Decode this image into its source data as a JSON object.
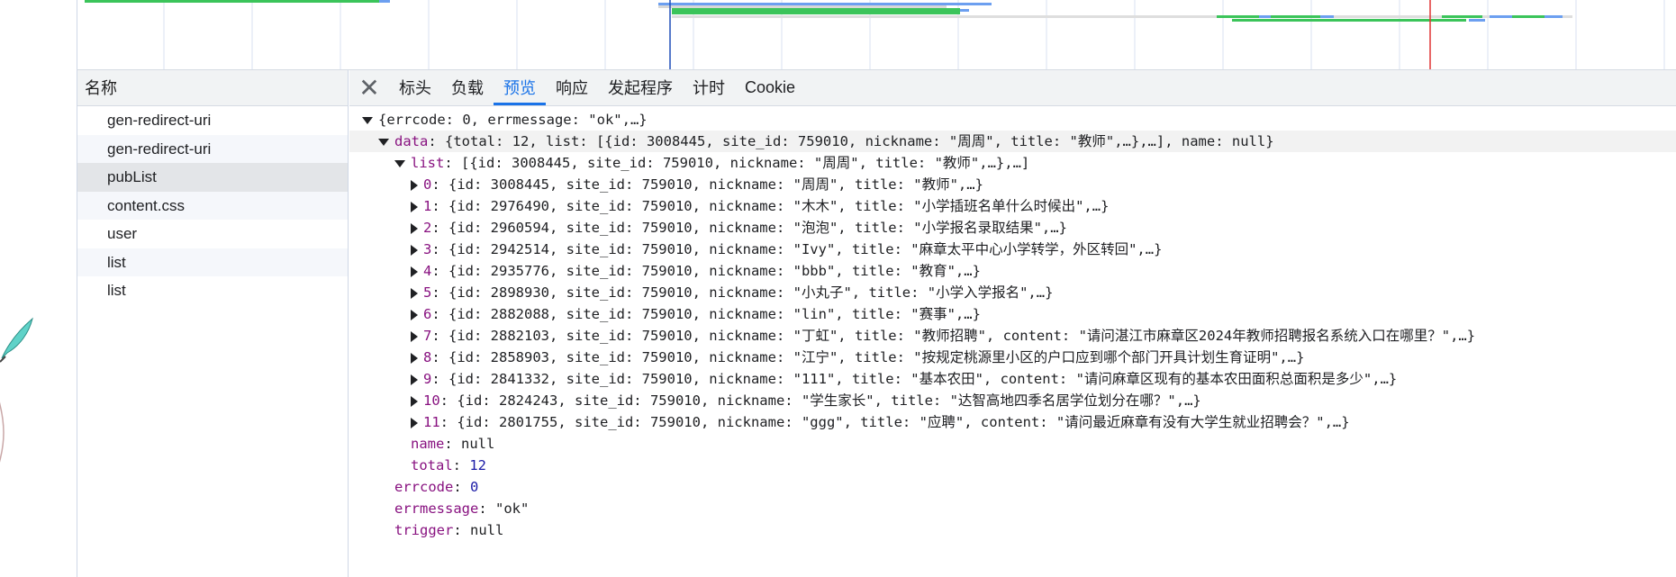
{
  "colors": {
    "timeline_green": "#3bc45a",
    "timeline_blue": "#6c9ff0",
    "timeline_red": "#e03434",
    "timeline_marker_blue": "#1f4db8",
    "key_color": "#881280",
    "number_color": "#1a1aa6",
    "active_tab": "#1a73e8"
  },
  "requests_panel": {
    "header": "名称",
    "items": [
      {
        "label": "gen-redirect-uri"
      },
      {
        "label": "gen-redirect-uri"
      },
      {
        "label": "pubList"
      },
      {
        "label": "content.css"
      },
      {
        "label": "user"
      },
      {
        "label": "list"
      },
      {
        "label": "list"
      }
    ]
  },
  "tabs": {
    "close_icon": "close-icon",
    "items": [
      {
        "label": "标头"
      },
      {
        "label": "负载"
      },
      {
        "label": "预览",
        "active": true
      },
      {
        "label": "响应"
      },
      {
        "label": "发起程序"
      },
      {
        "label": "计时"
      },
      {
        "label": "Cookie"
      }
    ]
  },
  "preview": {
    "root": "{errcode: 0, errmessage: \"ok\",…}",
    "data_key": "data",
    "data_summary": "{total: 12, list: [{id: 3008445, site_id: 759010, nickname: \"周周\", title: \"教师\",…},…], name: null}",
    "list_key": "list",
    "list_summary": "[{id: 3008445, site_id: 759010, nickname: \"周周\", title: \"教师\",…},…]",
    "list_items": [
      {
        "index": "0",
        "summary": "{id: 3008445, site_id: 759010, nickname: \"周周\", title: \"教师\",…}"
      },
      {
        "index": "1",
        "summary": "{id: 2976490, site_id: 759010, nickname: \"木木\", title: \"小学插班名单什么时候出\",…}"
      },
      {
        "index": "2",
        "summary": "{id: 2960594, site_id: 759010, nickname: \"泡泡\", title: \"小学报名录取结果\",…}"
      },
      {
        "index": "3",
        "summary": "{id: 2942514, site_id: 759010, nickname: \"Ivy\", title: \"麻章太平中心小学转学，外区转回\",…}"
      },
      {
        "index": "4",
        "summary": "{id: 2935776, site_id: 759010, nickname: \"bbb\", title: \"教育\",…}"
      },
      {
        "index": "5",
        "summary": "{id: 2898930, site_id: 759010, nickname: \"小丸子\", title: \"小学入学报名\",…}"
      },
      {
        "index": "6",
        "summary": "{id: 2882088, site_id: 759010, nickname: \"lin\", title: \"赛事\",…}"
      },
      {
        "index": "7",
        "summary": "{id: 2882103, site_id: 759010, nickname: \"丁虹\", title: \"教师招聘\", content: \"请问湛江市麻章区2024年教师招聘报名系统入口在哪里？\",…}"
      },
      {
        "index": "8",
        "summary": "{id: 2858903, site_id: 759010, nickname: \"江宁\", title: \"按规定桃源里小区的户口应到哪个部门开具计划生育证明\",…}"
      },
      {
        "index": "9",
        "summary": "{id: 2841332, site_id: 759010, nickname: \"111\", title: \"基本农田\", content: \"请问麻章区现有的基本农田面积总面积是多少\",…}"
      },
      {
        "index": "10",
        "summary": "{id: 2824243, site_id: 759010, nickname: \"学生家长\", title: \"达智高地四季名居学位划分在哪？\",…}"
      },
      {
        "index": "11",
        "summary": "{id: 2801755, site_id: 759010, nickname: \"ggg\", title: \"应聘\", content: \"请问最近麻章有没有大学生就业招聘会？\",…}"
      }
    ],
    "name_key": "name",
    "name_value": "null",
    "total_key": "total",
    "total_value": "12",
    "errcode_key": "errcode",
    "errcode_value": "0",
    "errmessage_key": "errmessage",
    "errmessage_value": "\"ok\"",
    "trigger_key": "trigger",
    "trigger_value": "null"
  }
}
